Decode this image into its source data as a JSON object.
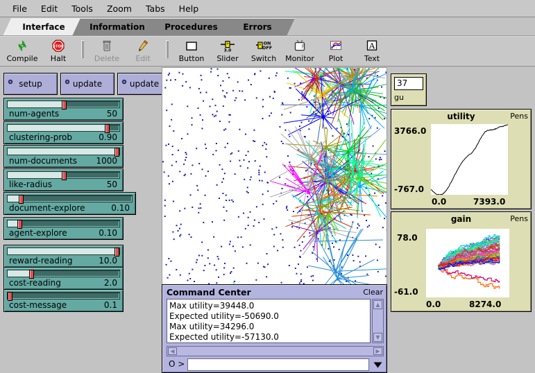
{
  "menu": {
    "items": [
      "File",
      "Edit",
      "Tools",
      "Zoom",
      "Tabs",
      "Help"
    ]
  },
  "tabs": [
    {
      "label": "Interface",
      "active": true
    },
    {
      "label": "Information",
      "active": false
    },
    {
      "label": "Procedures",
      "active": false
    },
    {
      "label": "Errors",
      "active": false
    }
  ],
  "toolbar": {
    "items": [
      {
        "label": "Compile",
        "icon": "recycle-icon",
        "disabled": false
      },
      {
        "label": "Halt",
        "icon": "stop-sign-icon",
        "disabled": false
      },
      {
        "label": "Delete",
        "icon": "trash-icon",
        "disabled": true
      },
      {
        "label": "Edit",
        "icon": "pencil-icon",
        "disabled": true
      },
      {
        "label": "Button",
        "icon": "button-icon",
        "disabled": false
      },
      {
        "label": "Slider",
        "icon": "slider-icon",
        "disabled": false
      },
      {
        "label": "Switch",
        "icon": "switch-icon",
        "disabled": false
      },
      {
        "label": "Monitor",
        "icon": "monitor-icon",
        "disabled": false
      },
      {
        "label": "Plot",
        "icon": "plot-icon",
        "disabled": false
      },
      {
        "label": "Text",
        "icon": "text-icon",
        "disabled": false
      }
    ]
  },
  "buttons": [
    {
      "label": "setup",
      "forever": false
    },
    {
      "label": "update",
      "forever": false
    },
    {
      "label": "update",
      "forever": true
    }
  ],
  "sliders": [
    {
      "name": "num-agents",
      "value": "50",
      "fraction": 0.5,
      "wide": false
    },
    {
      "name": "clustering-prob",
      "value": "0.90",
      "fraction": 0.9,
      "wide": false
    },
    {
      "name": "num-documents",
      "value": "1000",
      "fraction": 1.0,
      "wide": false
    },
    {
      "name": "like-radius",
      "value": "50",
      "fraction": 0.5,
      "wide": false
    },
    {
      "name": "document-explore",
      "value": "0.10",
      "fraction": 0.095,
      "wide": true
    },
    {
      "name": "agent-explore",
      "value": "0.10",
      "fraction": 0.095,
      "wide": false
    },
    {
      "name": "reward-reading",
      "value": "10.0",
      "fraction": 1.0,
      "wide": false
    },
    {
      "name": "cost-reading",
      "value": "2.0",
      "fraction": 0.205,
      "wide": false
    },
    {
      "name": "cost-message",
      "value": "0.1",
      "fraction": 0.01,
      "wide": false
    }
  ],
  "monitor": {
    "value": "37",
    "label": "gu"
  },
  "chart_data": [
    {
      "type": "line",
      "title": "utility",
      "pens_label": "Pens",
      "xlabel": "",
      "ylabel": "",
      "xlim": [
        0.0,
        7393.0
      ],
      "ylim": [
        -767.0,
        3766.0
      ],
      "xmin_label": "0.0",
      "xmax_label": "7393.0",
      "ymin_label": "-767.0",
      "ymax_label": "3766.0",
      "grid": false,
      "legend": "none",
      "series": [
        {
          "name": "utility",
          "color": "#000000",
          "x": [
            0,
            200,
            420,
            650,
            870,
            1100,
            1330,
            1550,
            1780,
            2000,
            2220,
            2450,
            2680,
            2900,
            3120,
            3350,
            3580,
            3800,
            4020,
            4250,
            4480,
            4700,
            4920,
            5150,
            5380,
            5600,
            5820,
            6050,
            6280,
            6500,
            6720,
            6950,
            7180,
            7393
          ],
          "y": [
            -430,
            -560,
            -690,
            -760,
            -767,
            -740,
            -600,
            -400,
            -160,
            120,
            420,
            700,
            980,
            1230,
            1430,
            1600,
            1760,
            1850,
            1990,
            2200,
            2470,
            2760,
            3020,
            3230,
            3350,
            3380,
            3400,
            3430,
            3480,
            3560,
            3600,
            3620,
            3700,
            3740
          ]
        }
      ]
    },
    {
      "type": "line",
      "title": "gain",
      "pens_label": "Pens",
      "xlabel": "",
      "ylabel": "",
      "xlim": [
        0.0,
        8274.0
      ],
      "ylim": [
        -61.0,
        78.0
      ],
      "xmin_label": "0.0",
      "xmax_label": "8274.0",
      "ymin_label": "-61.0",
      "ymax_label": "78.0",
      "grid": false,
      "legend": "none",
      "note": "multi-pen spaghetti plot: ~40 per-agent gain traces fanning out from a common origin near x=1500",
      "pen_colors": [
        "#ff0000",
        "#0000ff",
        "#00c000",
        "#00cccc",
        "#ff00ff",
        "#ffcc00",
        "#9966cc",
        "#996633",
        "#ff6600",
        "#33cc66",
        "#6699ff",
        "#cc0066",
        "#999900",
        "#00ff99",
        "#cc66ff",
        "#66cc00",
        "#ff3399",
        "#3366cc",
        "#999999",
        "#cc3300"
      ]
    }
  ],
  "command_center": {
    "title": "Command Center",
    "clear_label": "Clear",
    "lines": [
      "Max utility=39448.0",
      "Expected utility=-50690.0",
      "Max utility=34296.0",
      "Expected utility=-57130.0"
    ],
    "prompt": "O >",
    "input_value": "",
    "input_placeholder": ""
  },
  "colors": {
    "widget_button": "#aeaed8",
    "widget_slider": "#64a9a2",
    "plot_bg": "#dedeb4",
    "command_center": "#b4b4e0",
    "chrome": "#c8c8c8"
  }
}
